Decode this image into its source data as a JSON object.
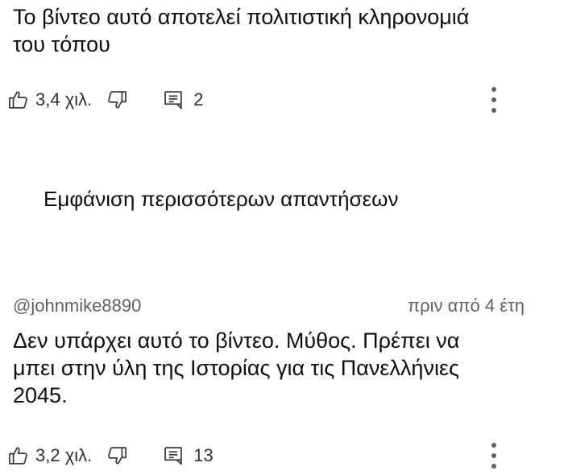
{
  "comment1": {
    "text": "Το βίντεο αυτό αποτελεί πολιτιστική κληρονομιά\nτου τόπου",
    "likes": "3,4 χιλ.",
    "replies": "2"
  },
  "show_more_replies_label": "Εμφάνιση περισσότερων απαντήσεων",
  "comment2": {
    "author": "@johnmike8890",
    "timestamp": "πριν από 4 έτη",
    "text": "Δεν υπάρχει αυτό το βίντεο. Μύθος. Πρέπει να\nμπει στην ύλη της Ιστορίας για τις Πανελλήνιες\n2045.",
    "likes": "3,2 χιλ.",
    "replies": "13"
  },
  "icons": {
    "like": "thumbs-up-icon",
    "dislike": "thumbs-down-icon",
    "reply": "reply-comment-icon",
    "more": "more-vertical-icon"
  }
}
